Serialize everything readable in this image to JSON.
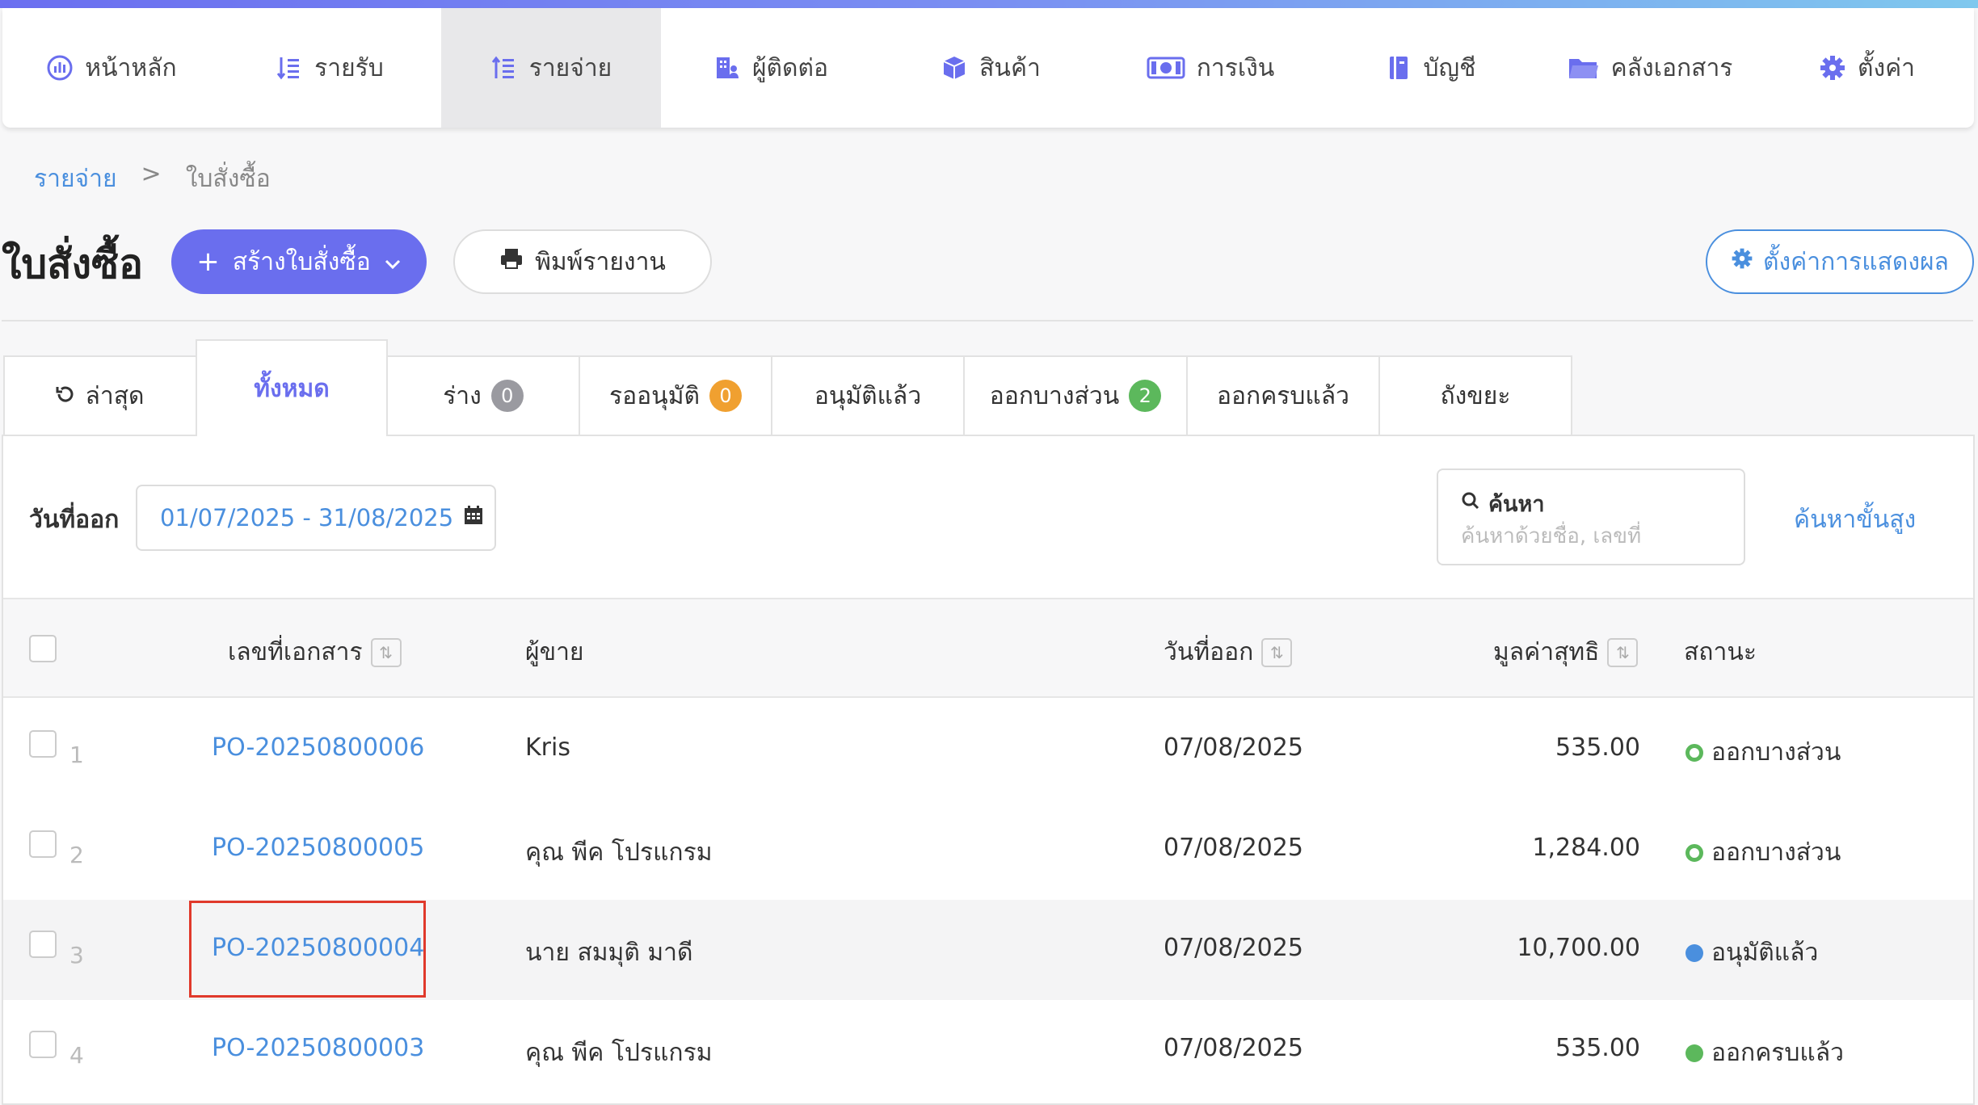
{
  "nav": {
    "items": [
      {
        "label": "หน้าหลัก",
        "icon": "dashboard-icon"
      },
      {
        "label": "รายรับ",
        "icon": "income-icon"
      },
      {
        "label": "รายจ่าย",
        "icon": "expense-icon"
      },
      {
        "label": "ผู้ติดต่อ",
        "icon": "contacts-icon"
      },
      {
        "label": "สินค้า",
        "icon": "box-icon"
      },
      {
        "label": "การเงิน",
        "icon": "money-icon"
      },
      {
        "label": "บัญชี",
        "icon": "ledger-icon"
      },
      {
        "label": "คลังเอกสาร",
        "icon": "folder-icon"
      },
      {
        "label": "ตั้งค่า",
        "icon": "gear-icon"
      }
    ],
    "active_index": 2
  },
  "breadcrumb": {
    "parent": "รายจ่าย",
    "separator": ">",
    "current": "ใบสั่งซื้อ"
  },
  "page": {
    "title": "ใบสั่งซื้อ",
    "create_button": "สร้างใบสั่งซื้อ",
    "print_button": "พิมพ์รายงาน",
    "display_settings_button": "ตั้งค่าการแสดงผล"
  },
  "tabs": [
    {
      "label": "ล่าสุด"
    },
    {
      "label": "ทั้งหมด",
      "active": true
    },
    {
      "label": "ร่าง",
      "badge": "0",
      "badge_color": "#9a9aa0"
    },
    {
      "label": "รออนุมัติ",
      "badge": "0",
      "badge_color": "#f0a030"
    },
    {
      "label": "อนุมัติแล้ว"
    },
    {
      "label": "ออกบางส่วน",
      "badge": "2",
      "badge_color": "#5cb85c"
    },
    {
      "label": "ออกครบแล้ว"
    },
    {
      "label": "ถังขยะ"
    }
  ],
  "filter": {
    "date_label": "วันที่ออก",
    "date_range": "01/07/2025 - 31/08/2025",
    "search_title": "ค้นหา",
    "search_placeholder": "ค้นหาด้วยชื่อ, เลขที่",
    "advanced_search": "ค้นหาขั้นสูง"
  },
  "table": {
    "headers": {
      "doc_no": "เลขที่เอกสาร",
      "vendor": "ผู้ขาย",
      "issue_date": "วันที่ออก",
      "net_value": "มูลค่าสุทธิ",
      "status": "สถานะ"
    },
    "rows": [
      {
        "num": "1",
        "doc_no": "PO-20250800006",
        "vendor": "Kris",
        "issue_date": "07/08/2025",
        "net_value": "535.00",
        "status": "ออกบางส่วน",
        "status_color": "#5cb85c",
        "status_style": "ring"
      },
      {
        "num": "2",
        "doc_no": "PO-20250800005",
        "vendor": "คุณ พีค โปรแกรม",
        "issue_date": "07/08/2025",
        "net_value": "1,284.00",
        "status": "ออกบางส่วน",
        "status_color": "#5cb85c",
        "status_style": "ring"
      },
      {
        "num": "3",
        "doc_no": "PO-20250800004",
        "vendor": "นาย สมมุติ มาดี",
        "issue_date": "07/08/2025",
        "net_value": "10,700.00",
        "status": "อนุมัติแล้ว",
        "status_color": "#4a8fde",
        "status_style": "dot"
      },
      {
        "num": "4",
        "doc_no": "PO-20250800003",
        "vendor": "คุณ พีค โปรแกรม",
        "issue_date": "07/08/2025",
        "net_value": "535.00",
        "status": "ออกครบแล้ว",
        "status_color": "#5cb85c",
        "status_style": "dot"
      }
    ]
  },
  "colors": {
    "accent": "#6a6eee",
    "link": "#4a8fde",
    "highlight_box": "#e0392b"
  }
}
